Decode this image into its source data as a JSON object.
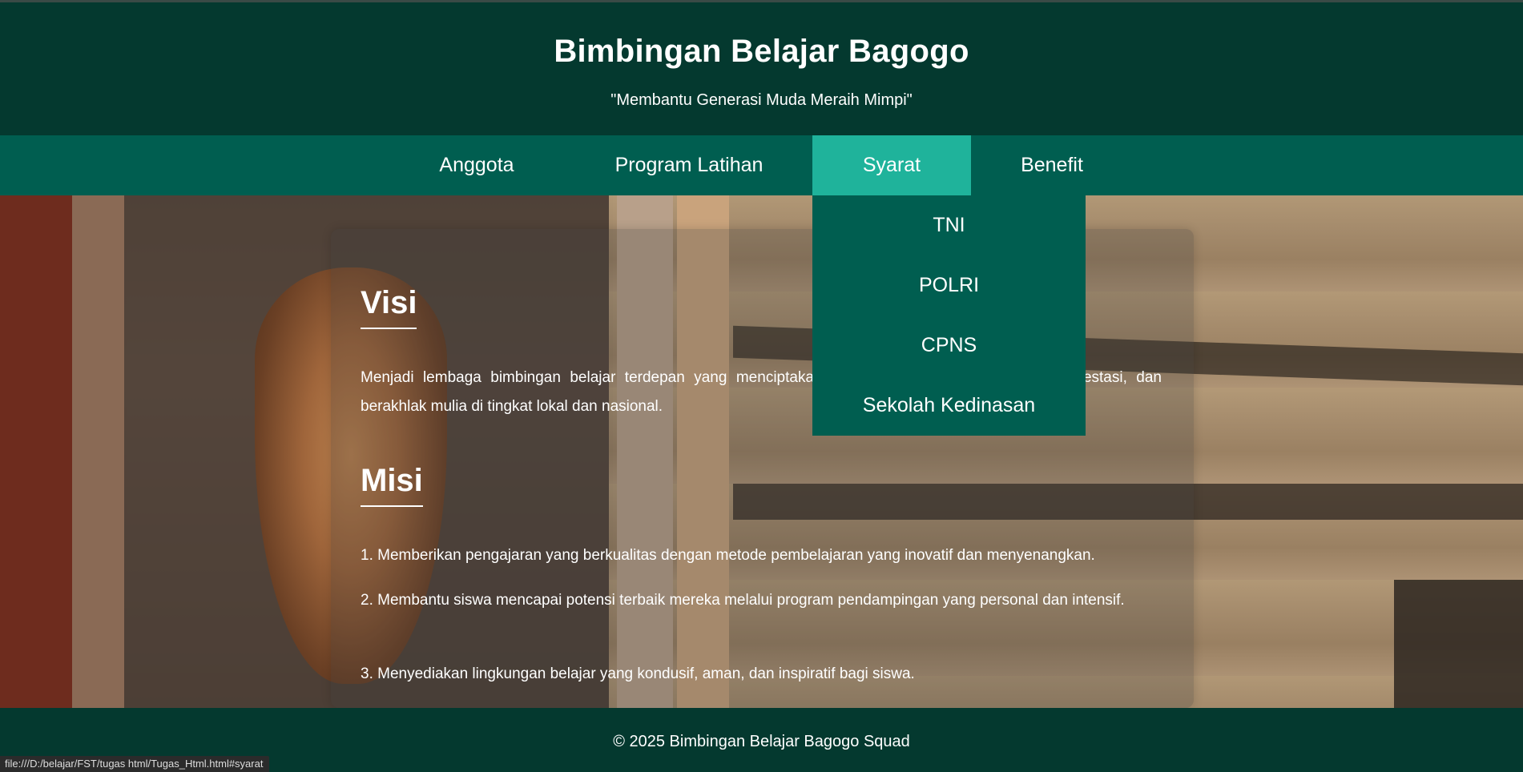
{
  "header": {
    "title": "Bimbingan Belajar Bagogo",
    "tagline": "\"Membantu Generasi Muda Meraih Mimpi\""
  },
  "nav": {
    "items": [
      {
        "label": "Anggota"
      },
      {
        "label": "Program Latihan"
      },
      {
        "label": "Syarat",
        "active": true
      },
      {
        "label": "Benefit"
      }
    ],
    "dropdown": [
      "TNI",
      "POLRI",
      "CPNS",
      "Sekolah Kedinasan"
    ]
  },
  "main": {
    "visi_title": "Visi",
    "visi_text": "Menjadi lembaga bimbingan belajar terdepan yang menciptakan generasi muda yang cerdas, berprestasi, dan berakhlak mulia di tingkat lokal dan nasional.",
    "misi_title": "Misi",
    "misi": [
      "1. Memberikan pengajaran yang berkualitas dengan metode pembelajaran yang inovatif dan menyenangkan.",
      "2. Membantu siswa mencapai potensi terbaik mereka melalui program pendampingan yang personal dan intensif.",
      "3. Menyediakan lingkungan belajar yang kondusif, aman, dan inspiratif bagi siswa."
    ]
  },
  "footer": {
    "text": "© 2025 Bimbingan Belajar Bagogo Squad"
  },
  "statusbar": {
    "url": "file:///D:/belajar/FST/tugas html/Tugas_Html.html#syarat"
  },
  "colors": {
    "header_bg": "#04392f",
    "nav_bg": "#005e50",
    "nav_active": "#1fb39b"
  }
}
